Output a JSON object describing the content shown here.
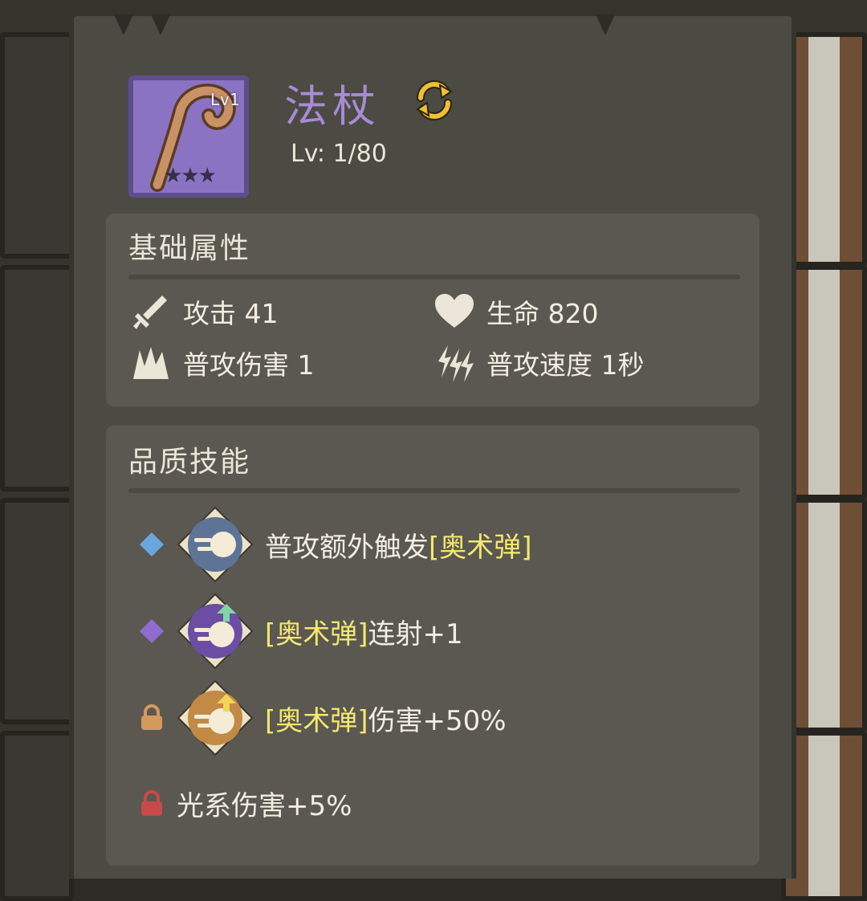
{
  "item": {
    "name": "法杖",
    "level_tag": "Lv1",
    "stars": "★★★",
    "level_text": "Lv: 1/80"
  },
  "basic": {
    "title": "基础属性",
    "attack": "攻击 41",
    "hp": "生命 820",
    "normal_damage": "普攻伤害 1",
    "attack_speed": "普攻速度 1秒"
  },
  "quality": {
    "title": "品质技能",
    "skills": [
      {
        "pre": "普攻额外触发",
        "hl": "[奥术弹]",
        "post": "",
        "marker": "blue-diamond-icon",
        "locked": false
      },
      {
        "pre": "",
        "hl": "[奥术弹]",
        "post": "连射+1",
        "marker": "purple-diamond-icon",
        "locked": false
      },
      {
        "pre": "",
        "hl": "[奥术弹]",
        "post": "伤害+50%",
        "marker": "lock-icon",
        "locked": true
      },
      {
        "pre": "光系伤害+5%",
        "hl": "",
        "post": "",
        "marker": "lock-icon",
        "locked": true
      }
    ]
  },
  "colors": {
    "title_purple": "#a88bd6",
    "highlight_yellow": "#f4e86e",
    "panel": "#4b4a43",
    "box": "#5a5851"
  }
}
